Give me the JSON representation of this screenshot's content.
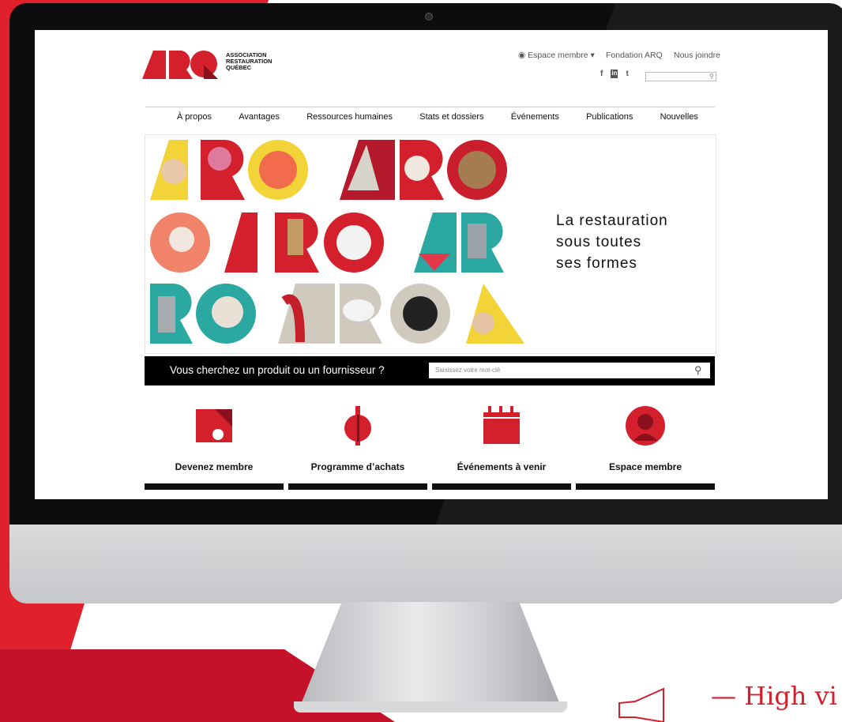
{
  "site": {
    "logo_lines": [
      "ASSOCIATION",
      "RESTAURATION",
      "QUÉBEC"
    ],
    "top_links": [
      "Espace membre",
      "Fondation ARQ",
      "Nous joindre"
    ],
    "social": [
      "f",
      "in",
      "t"
    ],
    "search_icon": "search-icon",
    "nav": [
      "À propos",
      "Avantages",
      "Ressources humaines",
      "Stats et dossiers",
      "Événements",
      "Publications",
      "Nouvelles"
    ],
    "hero_tagline": [
      "La restauration",
      "sous toutes",
      "ses formes"
    ],
    "searchbar": {
      "label": "Vous cherchez un produit ou un fournisseur ?",
      "placeholder": "Saisissez votre mot-clé"
    },
    "features": [
      "Devenez membre",
      "Programme d’achats",
      "Événements à venir",
      "Espace membre"
    ],
    "colors": {
      "brand_red": "#d4202c",
      "yellow": "#f2d338",
      "teal": "#2aa8a1",
      "grey": "#cfc9be"
    }
  },
  "ad_tagline": "— High vi"
}
